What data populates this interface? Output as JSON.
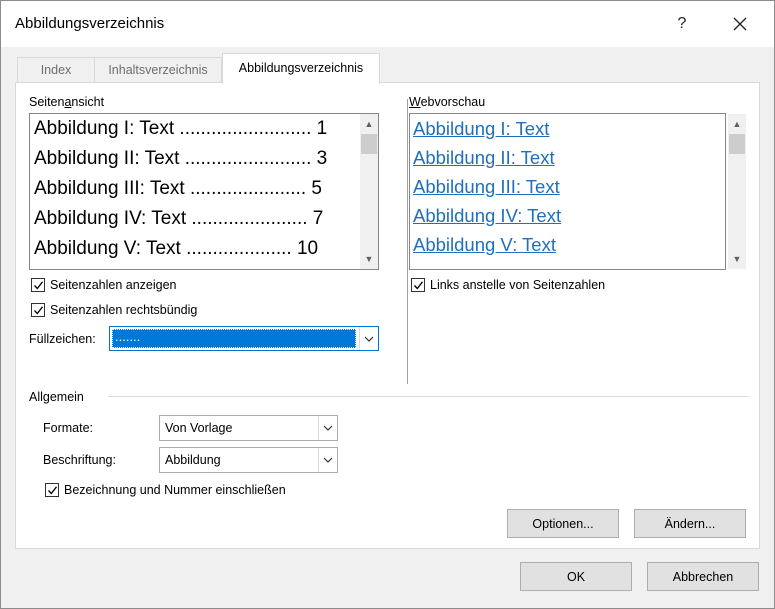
{
  "window": {
    "title": "Abbildungsverzeichnis",
    "help": "?",
    "close": "✕"
  },
  "tabs": [
    {
      "label": "Index"
    },
    {
      "label": "Inhaltsverzeichnis"
    },
    {
      "label": "Abbildungsverzeichnis"
    }
  ],
  "print_preview": {
    "label": "Seitenansicht",
    "entries": [
      {
        "text": "Abbildung I: Text ......................... 1"
      },
      {
        "text": "Abbildung II: Text ........................ 3"
      },
      {
        "text": "Abbildung III: Text ...................... 5"
      },
      {
        "text": "Abbildung IV: Text ...................... 7"
      },
      {
        "text": "Abbildung V: Text .................... 10"
      }
    ]
  },
  "web_preview": {
    "label": "Webvorschau",
    "entries": [
      {
        "text": "Abbildung I: Text"
      },
      {
        "text": "Abbildung II: Text"
      },
      {
        "text": "Abbildung III: Text"
      },
      {
        "text": "Abbildung IV: Text"
      },
      {
        "text": "Abbildung V: Text"
      }
    ]
  },
  "options": {
    "show_page_numbers": {
      "label": "Seitenzahlen anzeigen",
      "checked": true
    },
    "right_align": {
      "label": "Seitenzahlen rechtsbündig",
      "checked": true
    },
    "tab_leader": {
      "label": "Füllzeichen:",
      "value": "......."
    },
    "use_hyperlinks": {
      "label": "Links anstelle von Seitenzahlen",
      "checked": true
    }
  },
  "general": {
    "label": "Allgemein",
    "formats": {
      "label": "Formate:",
      "value": "Von Vorlage"
    },
    "caption": {
      "label": "Beschriftung:",
      "value": "Abbildung"
    },
    "include_label": {
      "label": "Bezeichnung und Nummer einschließen",
      "checked": true
    }
  },
  "buttons": {
    "options": "Optionen...",
    "modify": "Ändern...",
    "ok": "OK",
    "cancel": "Abbrechen"
  },
  "colors": {
    "link": "#1f6fbd",
    "selection": "#0078d7"
  }
}
